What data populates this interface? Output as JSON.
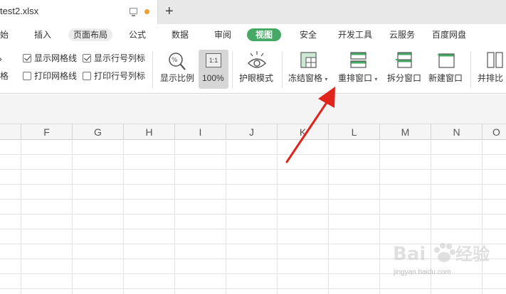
{
  "tab": {
    "filename": "test2.xlsx",
    "new_tab_label": "+"
  },
  "menu": [
    "始",
    "插入",
    "页面布局",
    "公式",
    "数据",
    "审阅",
    "视图",
    "安全",
    "开发工具",
    "云服务",
    "百度网盘"
  ],
  "ribbon": {
    "partial_label_1": "»",
    "partial_label_2": "格",
    "show_gridlines": "显示网格线",
    "show_headings": "显示行号列标",
    "print_gridlines": "打印网格线",
    "print_headings": "打印行号列标",
    "zoom": "显示比例",
    "zoom_100": "100%",
    "zoom_icon_text": "1:1",
    "eye_mode": "护眼模式",
    "freeze_panes": "冻结窗格",
    "arrange_windows": "重排窗口",
    "split_window": "拆分窗口",
    "new_window": "新建窗口",
    "side_by_side": "并排比",
    "caret": "▾"
  },
  "columns": [
    "F",
    "G",
    "H",
    "I",
    "J",
    "K",
    "L",
    "M",
    "N",
    "O"
  ],
  "checkbox_state": {
    "show_gridlines": true,
    "show_headings": true,
    "print_gridlines": false,
    "print_headings": false
  },
  "colors": {
    "view_tab": "#45a865",
    "arrow": "#e0241c",
    "unsaved_dot": "#f0a030"
  },
  "watermark": {
    "url": "jingyan.baidu.com"
  }
}
